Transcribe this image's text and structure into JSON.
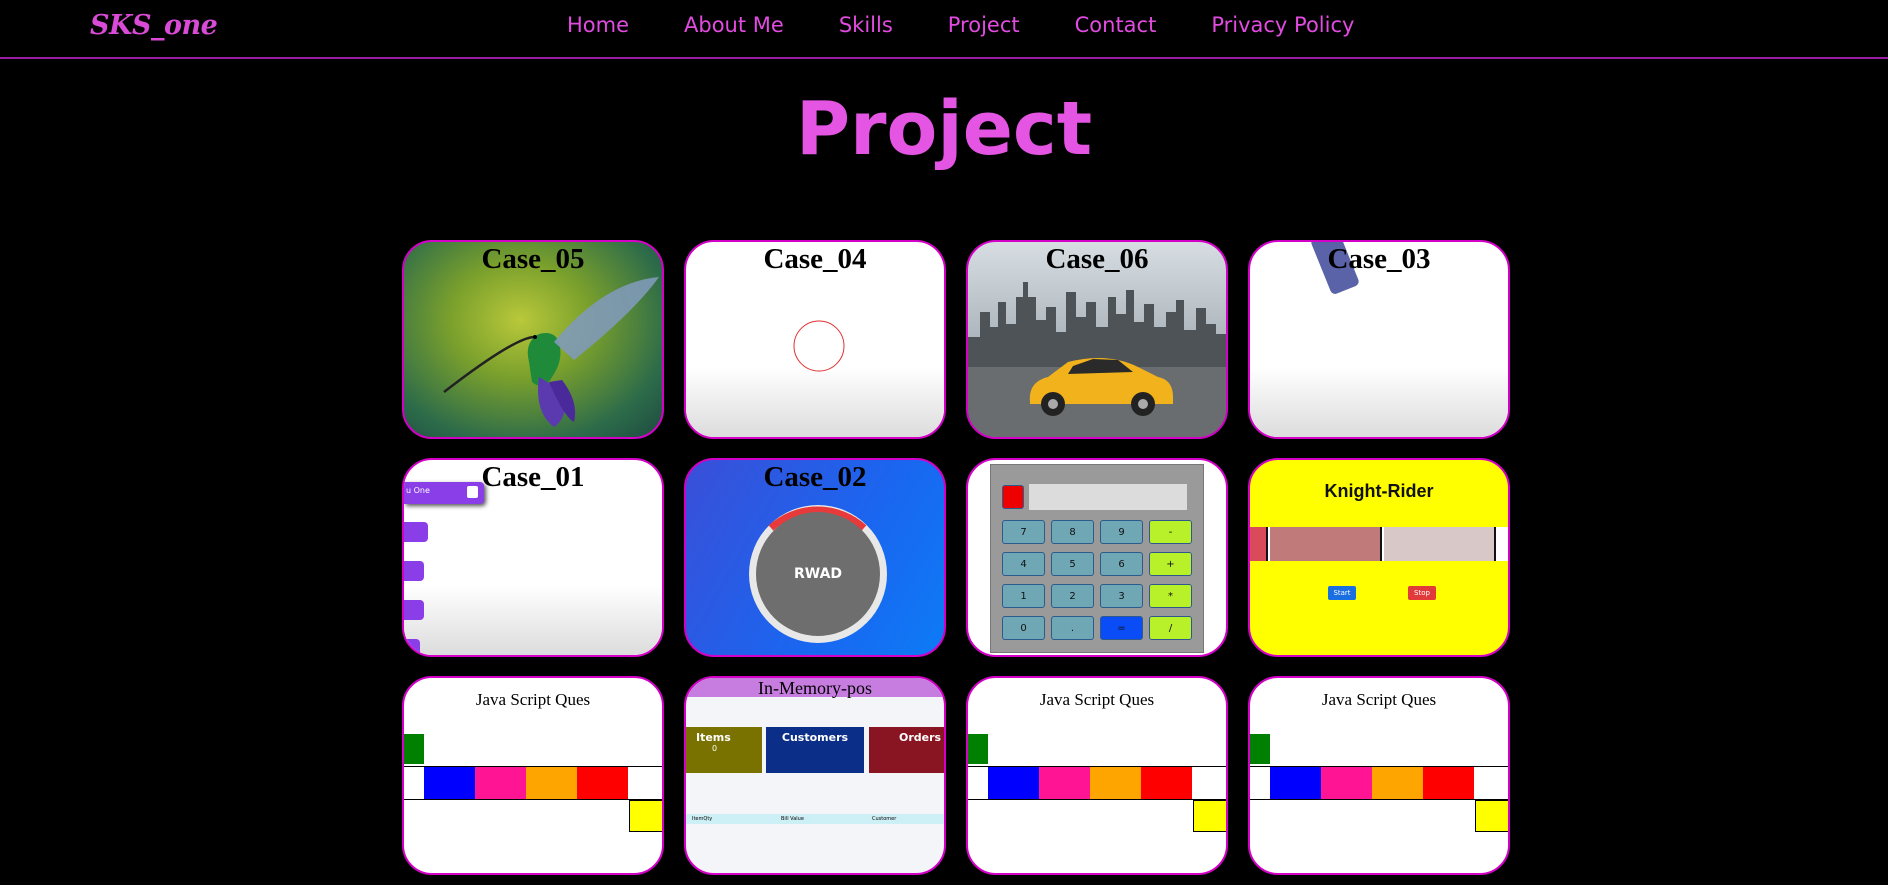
{
  "brand": {
    "logo": "SKS_one"
  },
  "nav": {
    "items": [
      {
        "label": "Home"
      },
      {
        "label": "About Me"
      },
      {
        "label": "Skills"
      },
      {
        "label": "Project"
      },
      {
        "label": "Contact"
      },
      {
        "label": "Privacy Policy"
      }
    ]
  },
  "page": {
    "title": "Project"
  },
  "projects": {
    "case05": {
      "title": "Case_05"
    },
    "case04": {
      "title": "Case_04"
    },
    "case06": {
      "title": "Case_06"
    },
    "case03": {
      "title": "Case_03"
    },
    "case01": {
      "title": "Case_01",
      "sidebar_label": "u One"
    },
    "case02": {
      "title": "Case_02",
      "button_label": "RWAD"
    },
    "calculator": {
      "keys": [
        "7",
        "8",
        "9",
        "-",
        "4",
        "5",
        "6",
        "+",
        "1",
        "2",
        "3",
        "*",
        "0",
        ".",
        "=",
        "/"
      ]
    },
    "knight_rider": {
      "title": "Knight-Rider",
      "start_label": "Start",
      "stop_label": "Stop"
    },
    "jsq1": {
      "title": "Java Script Ques"
    },
    "pos": {
      "title": "In-Memory-pos",
      "cards": [
        {
          "label": "Items",
          "value": "0"
        },
        {
          "label": "Customers",
          "value": ""
        },
        {
          "label": "Orders",
          "value": ""
        }
      ],
      "table_headers": [
        "ItemQty",
        "Bill Value",
        "Customer"
      ]
    },
    "jsq2": {
      "title": "Java Script Ques"
    },
    "jsq3": {
      "title": "Java Script Ques"
    }
  },
  "colors": {
    "accent": "#e24be0",
    "card_border": "#d400c8",
    "background": "#000000"
  }
}
